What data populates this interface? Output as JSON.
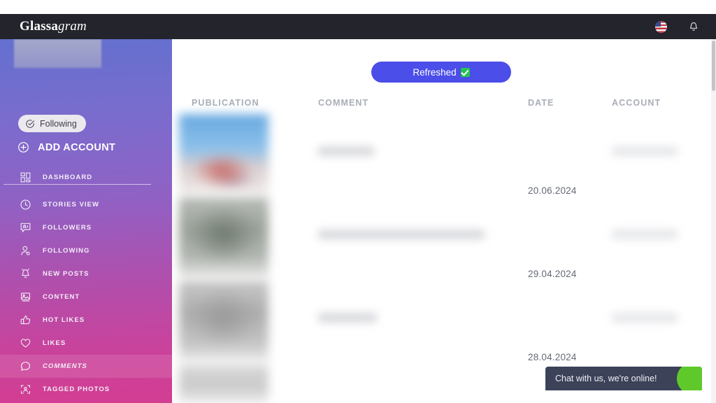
{
  "topbar": {
    "logo_bold": "Glassa",
    "logo_italic": "gram",
    "flag_icon": "us-flag-icon",
    "bell_icon": "bell-icon"
  },
  "sidebar": {
    "following_pill": {
      "label": "Following",
      "icon": "check-circle-icon"
    },
    "add_account": {
      "label": "ADD ACCOUNT",
      "icon": "plus-circle-icon"
    },
    "dashboard": {
      "label": "DASHBOARD",
      "icon": "grid-icon"
    },
    "items": [
      {
        "label": "STORIES VIEW",
        "icon": "clock-icon",
        "active": false
      },
      {
        "label": "FOLLOWERS",
        "icon": "user-badge-icon",
        "active": false
      },
      {
        "label": "FOLLOWING",
        "icon": "user-icon",
        "active": false
      },
      {
        "label": "NEW POSTS",
        "icon": "bell-icon",
        "active": false
      },
      {
        "label": "CONTENT",
        "icon": "image-icon",
        "active": false
      },
      {
        "label": "HOT LIKES",
        "icon": "thumbs-up-icon",
        "active": false
      },
      {
        "label": "LIKES",
        "icon": "heart-icon",
        "active": false
      },
      {
        "label": "COMMENTS",
        "icon": "speech-bubble-icon",
        "active": true
      },
      {
        "label": "TAGGED PHOTOS",
        "icon": "tagged-photo-icon",
        "active": false
      }
    ],
    "gradient_top": "#6470cf",
    "gradient_bottom": "#d33d92"
  },
  "main": {
    "refresh_button": {
      "label": "Refreshed",
      "icon": "green-check-icon",
      "color": "#4b4ee8"
    },
    "columns": [
      "PUBLICATION",
      "COMMENT",
      "DATE",
      "ACCOUNT"
    ],
    "rows": [
      {
        "date": "20.06.2024"
      },
      {
        "date": "29.04.2024"
      },
      {
        "date": "28.04.2024"
      },
      {
        "date": ""
      }
    ]
  },
  "chat": {
    "message": "Chat with us, we're online!",
    "status_color": "#5fc92c",
    "background": "#3c4258"
  }
}
